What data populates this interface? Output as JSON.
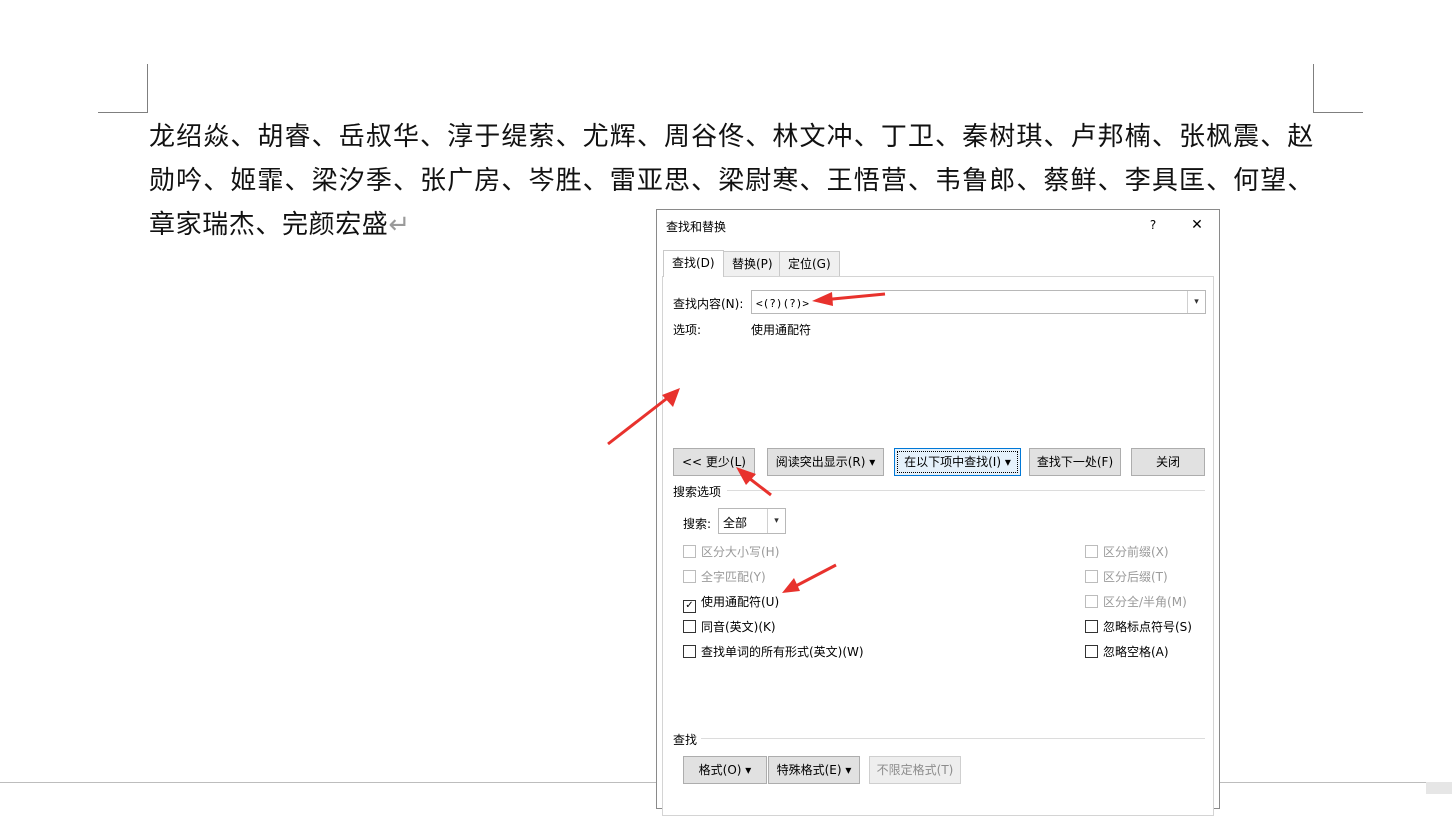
{
  "document": {
    "text": "龙绍焱、胡睿、岳叔华、淳于缇萦、尤辉、周谷佟、林文冲、丁卫、秦树琪、卢邦楠、张枫震、赵勋吟、姬霏、梁汐季、张广房、岑胜、雷亚思、梁尉寒、王悟营、韦鲁郎、蔡鲜、李具匡、何望、章家瑞杰、完颜宏盛",
    "paragraph_mark": "↵"
  },
  "dialog": {
    "title": "查找和替换",
    "help": "?",
    "close": "✕",
    "tabs": [
      {
        "label": "查找(D)"
      },
      {
        "label": "替换(P)"
      },
      {
        "label": "定位(G)"
      }
    ],
    "find_label": "查找内容(N):",
    "find_value": "<(?)(?)>",
    "options_label": "选项:",
    "options_value": "使用通配符",
    "buttons": {
      "less": "<< 更少(L)",
      "reading_highlight": "阅读突出显示(R)",
      "find_in": "在以下项中查找(I)",
      "find_next": "查找下一处(F)",
      "close": "关闭"
    },
    "search_options_title": "搜索选项",
    "search_label": "搜索:",
    "search_value": "全部",
    "checkboxes_left": [
      {
        "label": "区分大小写(H)",
        "checked": false,
        "enabled": false
      },
      {
        "label": "全字匹配(Y)",
        "checked": false,
        "enabled": false
      },
      {
        "label": "使用通配符(U)",
        "checked": true,
        "enabled": true
      },
      {
        "label": "同音(英文)(K)",
        "checked": false,
        "enabled": true
      },
      {
        "label": "查找单词的所有形式(英文)(W)",
        "checked": false,
        "enabled": true
      }
    ],
    "checkboxes_right": [
      {
        "label": "区分前缀(X)",
        "checked": false,
        "enabled": false
      },
      {
        "label": "区分后缀(T)",
        "checked": false,
        "enabled": false
      },
      {
        "label": "区分全/半角(M)",
        "checked": false,
        "enabled": false
      },
      {
        "label": "忽略标点符号(S)",
        "checked": false,
        "enabled": true
      },
      {
        "label": "忽略空格(A)",
        "checked": false,
        "enabled": true
      }
    ],
    "find_section_title": "查找",
    "bottom_buttons": {
      "format": "格式(O)",
      "special": "特殊格式(E)",
      "no_format": "不限定格式(T)"
    },
    "dropdown_glyph": "▾",
    "check_glyph": "✓"
  },
  "colors": {
    "annotation_arrow": "#e8322d",
    "focus_border": "#0078d7"
  }
}
